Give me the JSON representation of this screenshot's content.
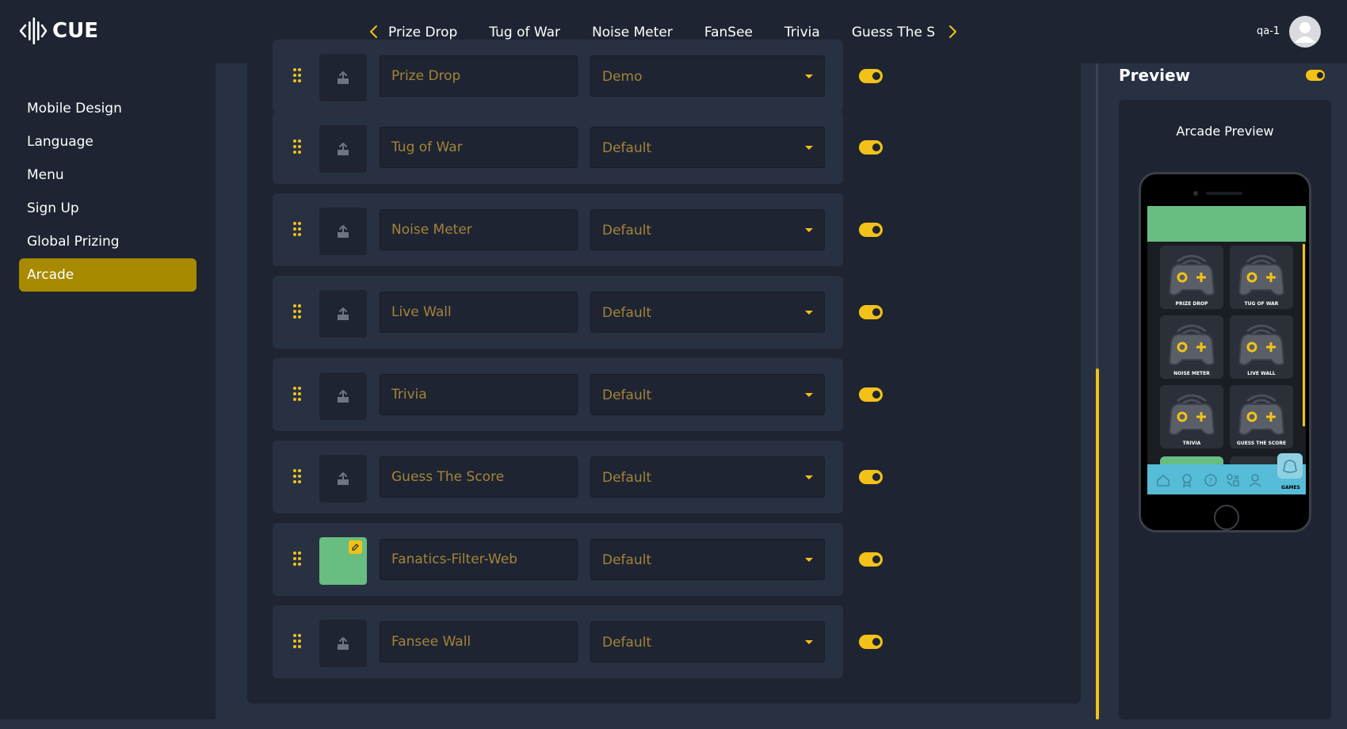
{
  "app": {
    "logo_text": "CUE"
  },
  "nav": {
    "tabs": [
      "Prize Drop",
      "Tug of War",
      "Noise Meter",
      "FanSee",
      "Trivia",
      "Guess The Score"
    ],
    "prev_icon": "chevron-left-icon",
    "next_icon": "chevron-right-icon"
  },
  "user": {
    "name": "qa-1",
    "avatar_icon": "user-avatar-icon"
  },
  "sidebar": {
    "items": [
      {
        "label": "Mobile Design"
      },
      {
        "label": "Language"
      },
      {
        "label": "Menu"
      },
      {
        "label": "Sign Up"
      },
      {
        "label": "Global Prizing"
      },
      {
        "label": "Arcade",
        "active": true
      }
    ]
  },
  "games": [
    {
      "name": "Prize Drop",
      "mode": "Demo",
      "enabled": true,
      "image": "upload-icon"
    },
    {
      "name": "Tug of War",
      "mode": "Default",
      "enabled": true,
      "image": "upload-icon"
    },
    {
      "name": "Noise Meter",
      "mode": "Default",
      "enabled": true,
      "image": "upload-icon"
    },
    {
      "name": "Live Wall",
      "mode": "Default",
      "enabled": true,
      "image": "upload-icon"
    },
    {
      "name": "Trivia",
      "mode": "Default",
      "enabled": true,
      "image": "upload-icon"
    },
    {
      "name": "Guess The Score",
      "mode": "Default",
      "enabled": true,
      "image": "upload-icon"
    },
    {
      "name": "Fanatics-Filter-Web",
      "mode": "Default",
      "enabled": true,
      "image": "green-thumbnail"
    },
    {
      "name": "Fansee Wall",
      "mode": "Default",
      "enabled": true,
      "image": "upload-icon"
    }
  ],
  "preview": {
    "title": "Preview",
    "enabled": true,
    "subtitle": "Arcade Preview",
    "tiles": [
      "PRIZE DROP",
      "TUG OF WAR",
      "NOISE METER",
      "LIVE WALL",
      "TRIVIA",
      "GUESS THE SCORE"
    ],
    "bottom_bar_label": "GAMES",
    "bottom_bar_icons": [
      "home-icon",
      "award-icon",
      "help-icon",
      "grid-icon",
      "profile-icon",
      "games-icon"
    ]
  },
  "colors": {
    "accent": "#f2c218",
    "active_sidebar": "#a88a00",
    "panel": "#1e2431",
    "background": "#283142",
    "green": "#68bd80",
    "bottom_bar": "#56bcd8"
  }
}
